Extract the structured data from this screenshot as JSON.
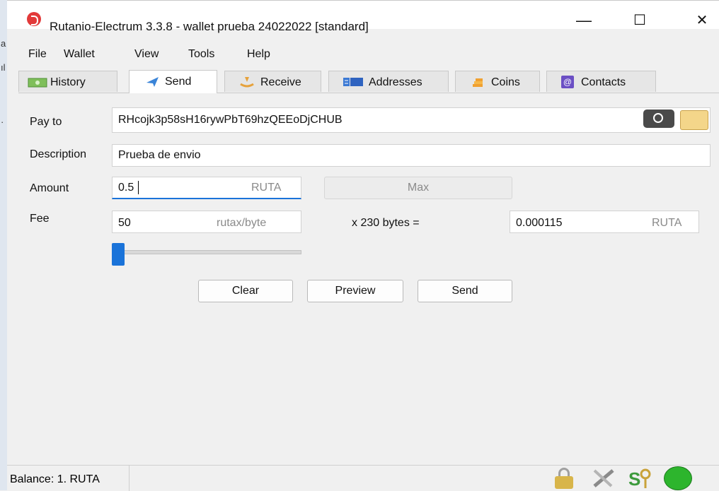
{
  "window": {
    "title": "Rutanio-Electrum 3.3.8  -  wallet prueba 24022022  [standard]",
    "minimize": "—",
    "maximize": "☐",
    "close": "✕"
  },
  "left_strip": {
    "chars": [
      "a",
      "ıl",
      "·"
    ]
  },
  "menu": {
    "file": "File",
    "wallet": "Wallet",
    "view": "View",
    "tools": "Tools",
    "help": "Help"
  },
  "tabs": {
    "history": "History",
    "send": "Send",
    "receive": "Receive",
    "addresses": "Addresses",
    "coins": "Coins",
    "contacts": "Contacts",
    "contacts_icon_glyph": "@"
  },
  "send": {
    "pay_to_label": "Pay to",
    "pay_to_value": "RHcojk3p58sH16rywPbT69hzQEEoDjCHUB",
    "description_label": "Description",
    "description_value": "Prueba de envio",
    "amount_label": "Amount",
    "amount_value": "0.5",
    "amount_unit": "RUTA",
    "max_label": "Max",
    "fee_label": "Fee",
    "fee_rate_value": "50",
    "fee_rate_unit": "rutax/byte",
    "size_text": "x  230 bytes  =",
    "fee_total_value": "0.000115",
    "fee_total_unit": "RUTA",
    "fee_slider_position": 0.0,
    "clear_label": "Clear",
    "preview_label": "Preview",
    "send_label": "Send"
  },
  "status": {
    "balance": "Balance: 1. RUTA",
    "network_color": "#2db52d"
  }
}
